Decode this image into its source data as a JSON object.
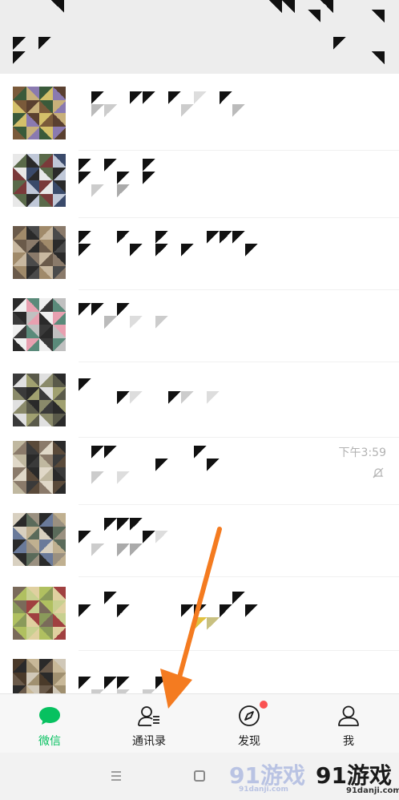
{
  "chats": [
    {
      "time": "",
      "muted": false
    },
    {
      "time": "",
      "muted": false
    },
    {
      "time": "",
      "muted": false
    },
    {
      "time": "",
      "muted": false
    },
    {
      "time": "",
      "muted": false
    },
    {
      "time": "下午3:59",
      "muted": true
    },
    {
      "time": "",
      "muted": false
    },
    {
      "time": "",
      "muted": false
    },
    {
      "time": "",
      "muted": false
    }
  ],
  "tabs": [
    {
      "label": "微信",
      "icon": "chat-bubble-icon",
      "active": true
    },
    {
      "label": "通讯录",
      "icon": "contacts-icon",
      "active": false,
      "highlighted_by_arrow": true
    },
    {
      "label": "发现",
      "icon": "compass-icon",
      "active": false,
      "badge": "dot"
    },
    {
      "label": "我",
      "icon": "person-icon",
      "active": false
    }
  ],
  "watermark": {
    "logo_1": "91游戏",
    "logo_1_sub": "91danji.com",
    "logo_2": "91游戏",
    "logo_2_sub": "91danji.com"
  },
  "colors": {
    "accent": "#07c160",
    "badge": "#fa5151",
    "arrow": "#f47b20"
  }
}
